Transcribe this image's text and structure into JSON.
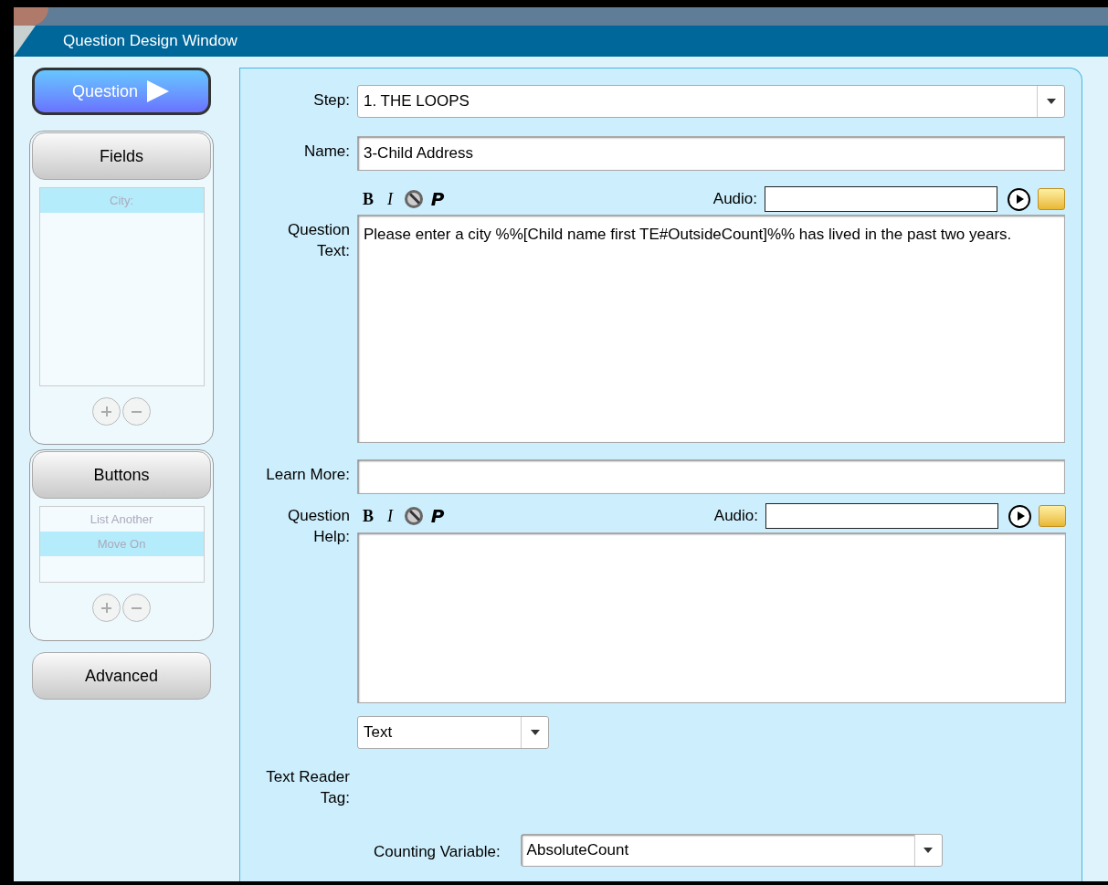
{
  "window": {
    "title": "Question Design Window"
  },
  "sidebar": {
    "sections": [
      {
        "label": "Question",
        "kind": "nav",
        "selected": true
      },
      {
        "label": "Fields",
        "kind": "list",
        "selected": false,
        "items": [
          {
            "label": "City:",
            "selected": true
          }
        ]
      },
      {
        "label": "Buttons",
        "kind": "list",
        "selected": false,
        "items": [
          {
            "label": "List Another",
            "selected": false
          },
          {
            "label": "Move On",
            "selected": true
          }
        ]
      },
      {
        "label": "Advanced",
        "kind": "nav",
        "selected": false
      }
    ]
  },
  "form": {
    "step": {
      "label": "Step:",
      "value": "1. THE LOOPS"
    },
    "name": {
      "label": "Name:",
      "value": "3-Child Address"
    },
    "question_text": {
      "label": "Question Text:",
      "value": "Please enter a city %%[Child name first TE#OutsideCount]%% has lived in the past two years.",
      "toolbar": [
        {
          "kind": "bold",
          "label": "B"
        },
        {
          "kind": "italic",
          "label": "I"
        },
        {
          "kind": "link"
        },
        {
          "kind": "plain",
          "label": "P"
        }
      ],
      "audio_label": "Audio:"
    },
    "learn_more": {
      "label": "Learn More:"
    },
    "question_help": {
      "label": "Question Help:",
      "toolbar": [
        {
          "kind": "bold",
          "label": "B"
        },
        {
          "kind": "italic",
          "label": "I"
        },
        {
          "kind": "link"
        },
        {
          "kind": "plain",
          "label": "P"
        }
      ],
      "audio_label": "Audio:"
    },
    "type": {
      "value": "Text"
    },
    "text_reader_tag": {
      "label": "Text Reader Tag:"
    },
    "counting_variable": {
      "label": "Counting Variable:",
      "value": "AbsoluteCount"
    }
  }
}
